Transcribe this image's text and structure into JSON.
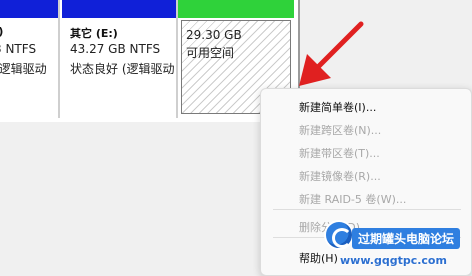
{
  "partitions": [
    {
      "name": ":)",
      "size": "3 NTFS",
      "status": "(逻辑驱动",
      "bar_color": "#1020d8"
    },
    {
      "name": "其它 (E:)",
      "size": "43.27 GB NTFS",
      "status": "状态良好 (逻辑驱动",
      "bar_color": "#1020d8"
    },
    {
      "size": "29.30 GB",
      "status": "可用空间",
      "bar_color": "#2fd23a"
    }
  ],
  "context_menu": {
    "items": [
      {
        "label": "新建简单卷(I)...",
        "enabled": true
      },
      {
        "label": "新建跨区卷(N)...",
        "enabled": false
      },
      {
        "label": "新建带区卷(T)...",
        "enabled": false
      },
      {
        "label": "新建镜像卷(R)...",
        "enabled": false
      },
      {
        "label": "新建 RAID-5 卷(W)...",
        "enabled": false
      },
      {
        "label": "删除分区(D)",
        "enabled": false
      },
      {
        "label": "帮助(H)",
        "enabled": true
      }
    ]
  },
  "annotation": {
    "arrow_color": "#e02020"
  },
  "watermark": {
    "title": "过期罐头电脑论坛",
    "url": "www.gqgtpc.com",
    "icon": "site-logo-icon"
  }
}
